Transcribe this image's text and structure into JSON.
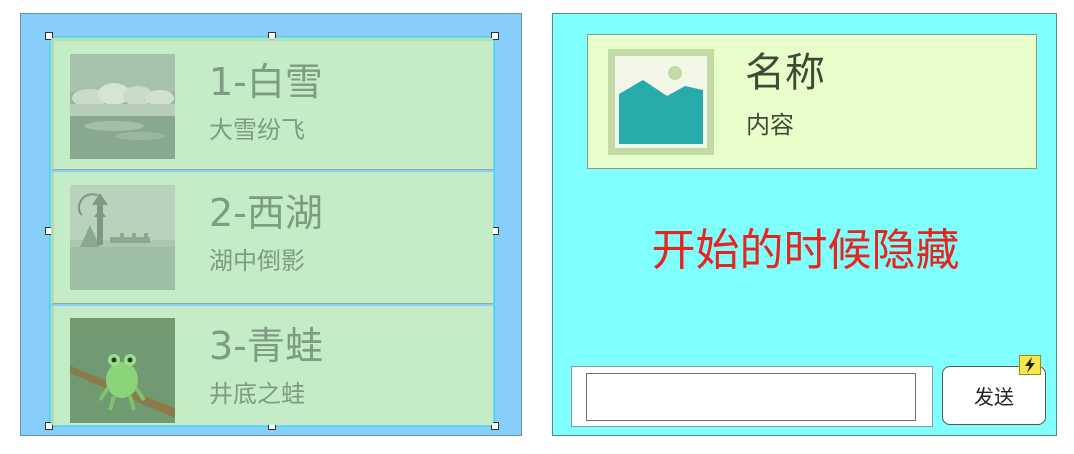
{
  "list": {
    "items": [
      {
        "title": "1-白雪",
        "subtitle": "大雪纷飞",
        "image": "snow-landscape-image"
      },
      {
        "title": "2-西湖",
        "subtitle": "湖中倒影",
        "image": "west-lake-pagoda-image"
      },
      {
        "title": "3-青蛙",
        "subtitle": "井底之蛙",
        "image": "frog-on-branch-image"
      }
    ]
  },
  "card": {
    "title": "名称",
    "subtitle": "内容",
    "image": "image-placeholder-icon"
  },
  "hidden_message": "开始的时候隐藏",
  "form": {
    "input_value": "",
    "input_placeholder": "",
    "send_label": "发送",
    "badge_icon": "lightning-bolt-icon"
  },
  "colors": {
    "left_panel_bg": "#87cefa",
    "list_item_bg": "#c4ecc6",
    "right_panel_bg": "#80ffff",
    "card_bg": "#e8ffcc",
    "hidden_message_color": "#e5261e",
    "badge_bg": "#f7e74a"
  }
}
